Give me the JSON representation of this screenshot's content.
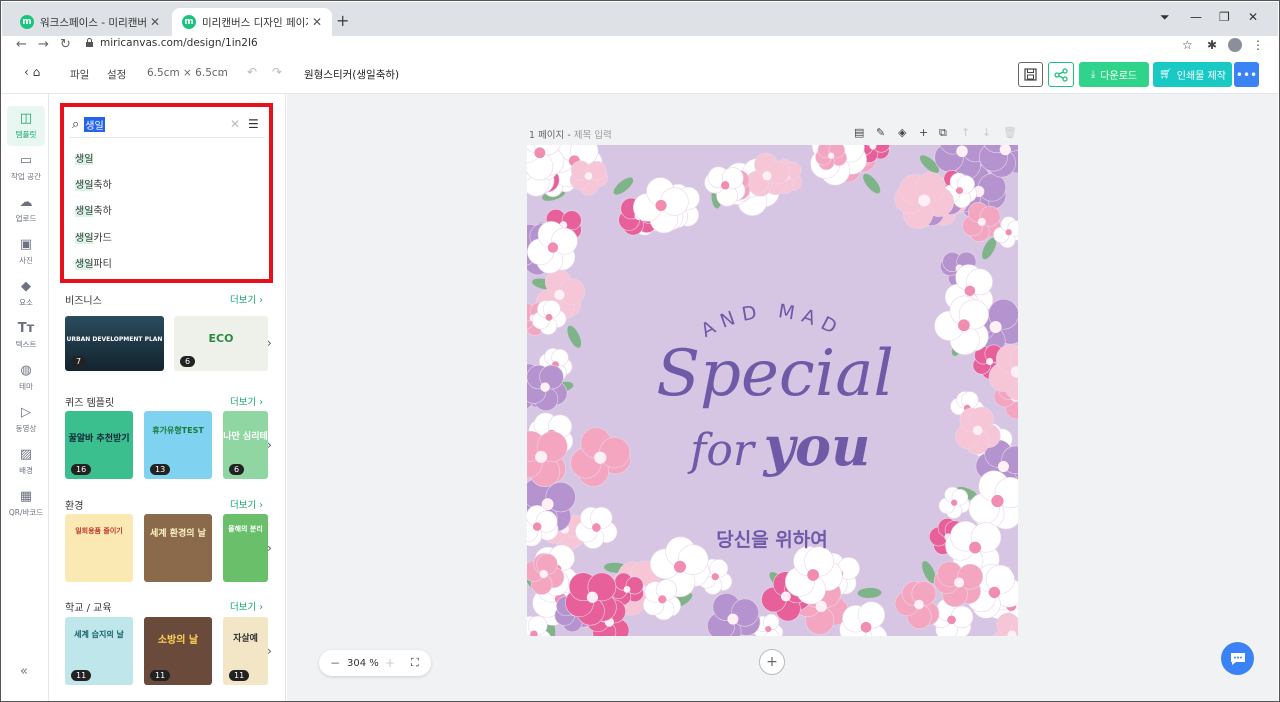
{
  "browser": {
    "tabs": [
      {
        "label": "워크스페이스 - 미리캔버스",
        "active": false
      },
      {
        "label": "미리캔버스 디자인 페이지",
        "active": true
      }
    ],
    "url": "miricanvas.com/design/1in2I6",
    "favicon_letter": "m"
  },
  "header": {
    "menu_file": "파일",
    "menu_settings": "설정",
    "size": "6.5cm × 6.5cm",
    "doc_title": "원형스티커(생일축하)",
    "download_label": "다운로드",
    "print_label": "인쇄물 제작"
  },
  "rail": {
    "items": [
      {
        "label": "템플릿",
        "icon": "template-icon",
        "active": true
      },
      {
        "label": "작업 공간",
        "icon": "workspace-icon",
        "active": false
      },
      {
        "label": "업로드",
        "icon": "upload-icon",
        "active": false
      },
      {
        "label": "사진",
        "icon": "photo-icon",
        "active": false
      },
      {
        "label": "요소",
        "icon": "elements-icon",
        "active": false
      },
      {
        "label": "텍스트",
        "icon": "text-icon",
        "active": false
      },
      {
        "label": "테마",
        "icon": "theme-icon",
        "active": false
      },
      {
        "label": "동영상",
        "icon": "video-icon",
        "active": false
      },
      {
        "label": "배경",
        "icon": "background-icon",
        "active": false
      },
      {
        "label": "QR/바코드",
        "icon": "qr-icon",
        "active": false
      }
    ]
  },
  "search": {
    "query": "생일",
    "suggestions": [
      {
        "hl": "생일",
        "rest": ""
      },
      {
        "hl": "생일",
        "rest": "축하"
      },
      {
        "hl": "생일",
        "rest": "축하"
      },
      {
        "hl": "생일",
        "rest": "카드"
      },
      {
        "hl": "생일",
        "rest": "파티"
      }
    ]
  },
  "sections": [
    {
      "title": "비즈니스",
      "more": "더보기",
      "thumbs": [
        {
          "text": "URBAN DEVELOPMENT PLAN",
          "count": "7"
        },
        {
          "text": "ECO",
          "count": "6"
        }
      ]
    },
    {
      "title": "퀴즈 템플릿",
      "more": "더보기",
      "thumbs": [
        {
          "text": "꿀알바 추천받기",
          "count": "16"
        },
        {
          "text": "휴가유형TEST",
          "count": "13"
        },
        {
          "text": "나만 심리테",
          "count": "6"
        }
      ]
    },
    {
      "title": "환경",
      "more": "더보기",
      "thumbs": [
        {
          "text": "일회용품 줄이기",
          "count": ""
        },
        {
          "text": "세계 환경의 날",
          "count": ""
        },
        {
          "text": "올해의 분리",
          "count": ""
        }
      ]
    },
    {
      "title": "학교 / 교육",
      "more": "더보기",
      "thumbs": [
        {
          "text": "세계 습지의 날",
          "count": "11"
        },
        {
          "text": "소방의 날",
          "count": "11"
        },
        {
          "text": "자살예",
          "count": "11"
        }
      ]
    }
  ],
  "workspace": {
    "page_label": "1 페이지",
    "page_title_placeholder": "제목 입력",
    "zoom": "304 %"
  },
  "design": {
    "arc_text": "AND MAD",
    "script_line1": "Special",
    "script_line2_a": "for",
    "script_line2_b": "you",
    "korean": "당신을 위하여",
    "bg_color": "#d7c6e3",
    "text_color": "#6f5aa8"
  }
}
